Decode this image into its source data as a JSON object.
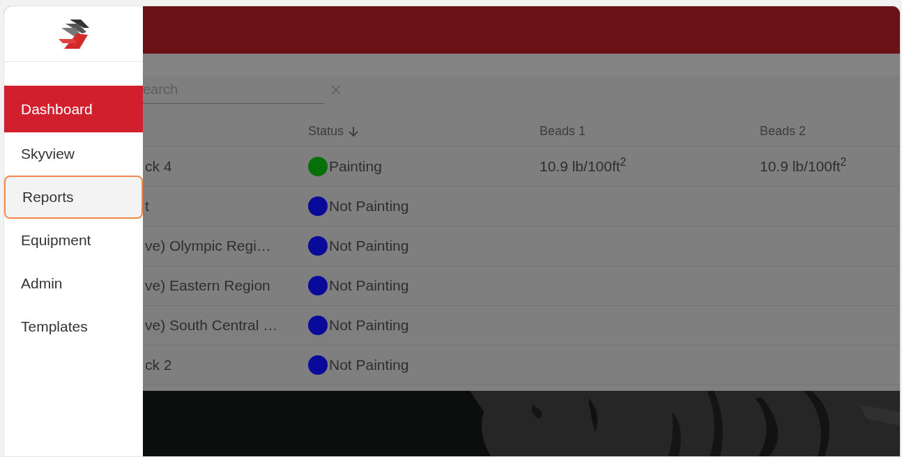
{
  "sidebar": {
    "items": [
      {
        "label": "Dashboard",
        "selected": true,
        "highlighted": false
      },
      {
        "label": "Skyview",
        "selected": false,
        "highlighted": false
      },
      {
        "label": "Reports",
        "selected": false,
        "highlighted": true
      },
      {
        "label": "Equipment",
        "selected": false,
        "highlighted": false
      },
      {
        "label": "Admin",
        "selected": false,
        "highlighted": false
      },
      {
        "label": "Templates",
        "selected": false,
        "highlighted": false
      }
    ]
  },
  "search": {
    "placeholder": "earch"
  },
  "table": {
    "columns": [
      {
        "label": "Status",
        "sorted": true
      },
      {
        "label": "Beads 1",
        "sorted": false
      },
      {
        "label": "Beads 2",
        "sorted": false
      }
    ],
    "rows": [
      {
        "name": "ck 4",
        "status": "Painting",
        "color": "#087008",
        "beads_1": "10.9 lb/100ft$^{2}$",
        "beads_2": "10.9 lb/100ft$^{2}$"
      },
      {
        "name": "t",
        "status": "Not Painting",
        "color": "#0a0a9a"
      },
      {
        "name": "ve) Olympic Regi…",
        "status": "Not Painting",
        "color": "#0a0a9a"
      },
      {
        "name": "ve) Eastern Region",
        "status": "Not Painting",
        "color": "#0a0a9a"
      },
      {
        "name": "ve) South Central …",
        "status": "Not Painting",
        "color": "#0a0a9a"
      },
      {
        "name": "ck 2",
        "status": "Not Painting",
        "color": "#0a0a9a"
      }
    ]
  }
}
